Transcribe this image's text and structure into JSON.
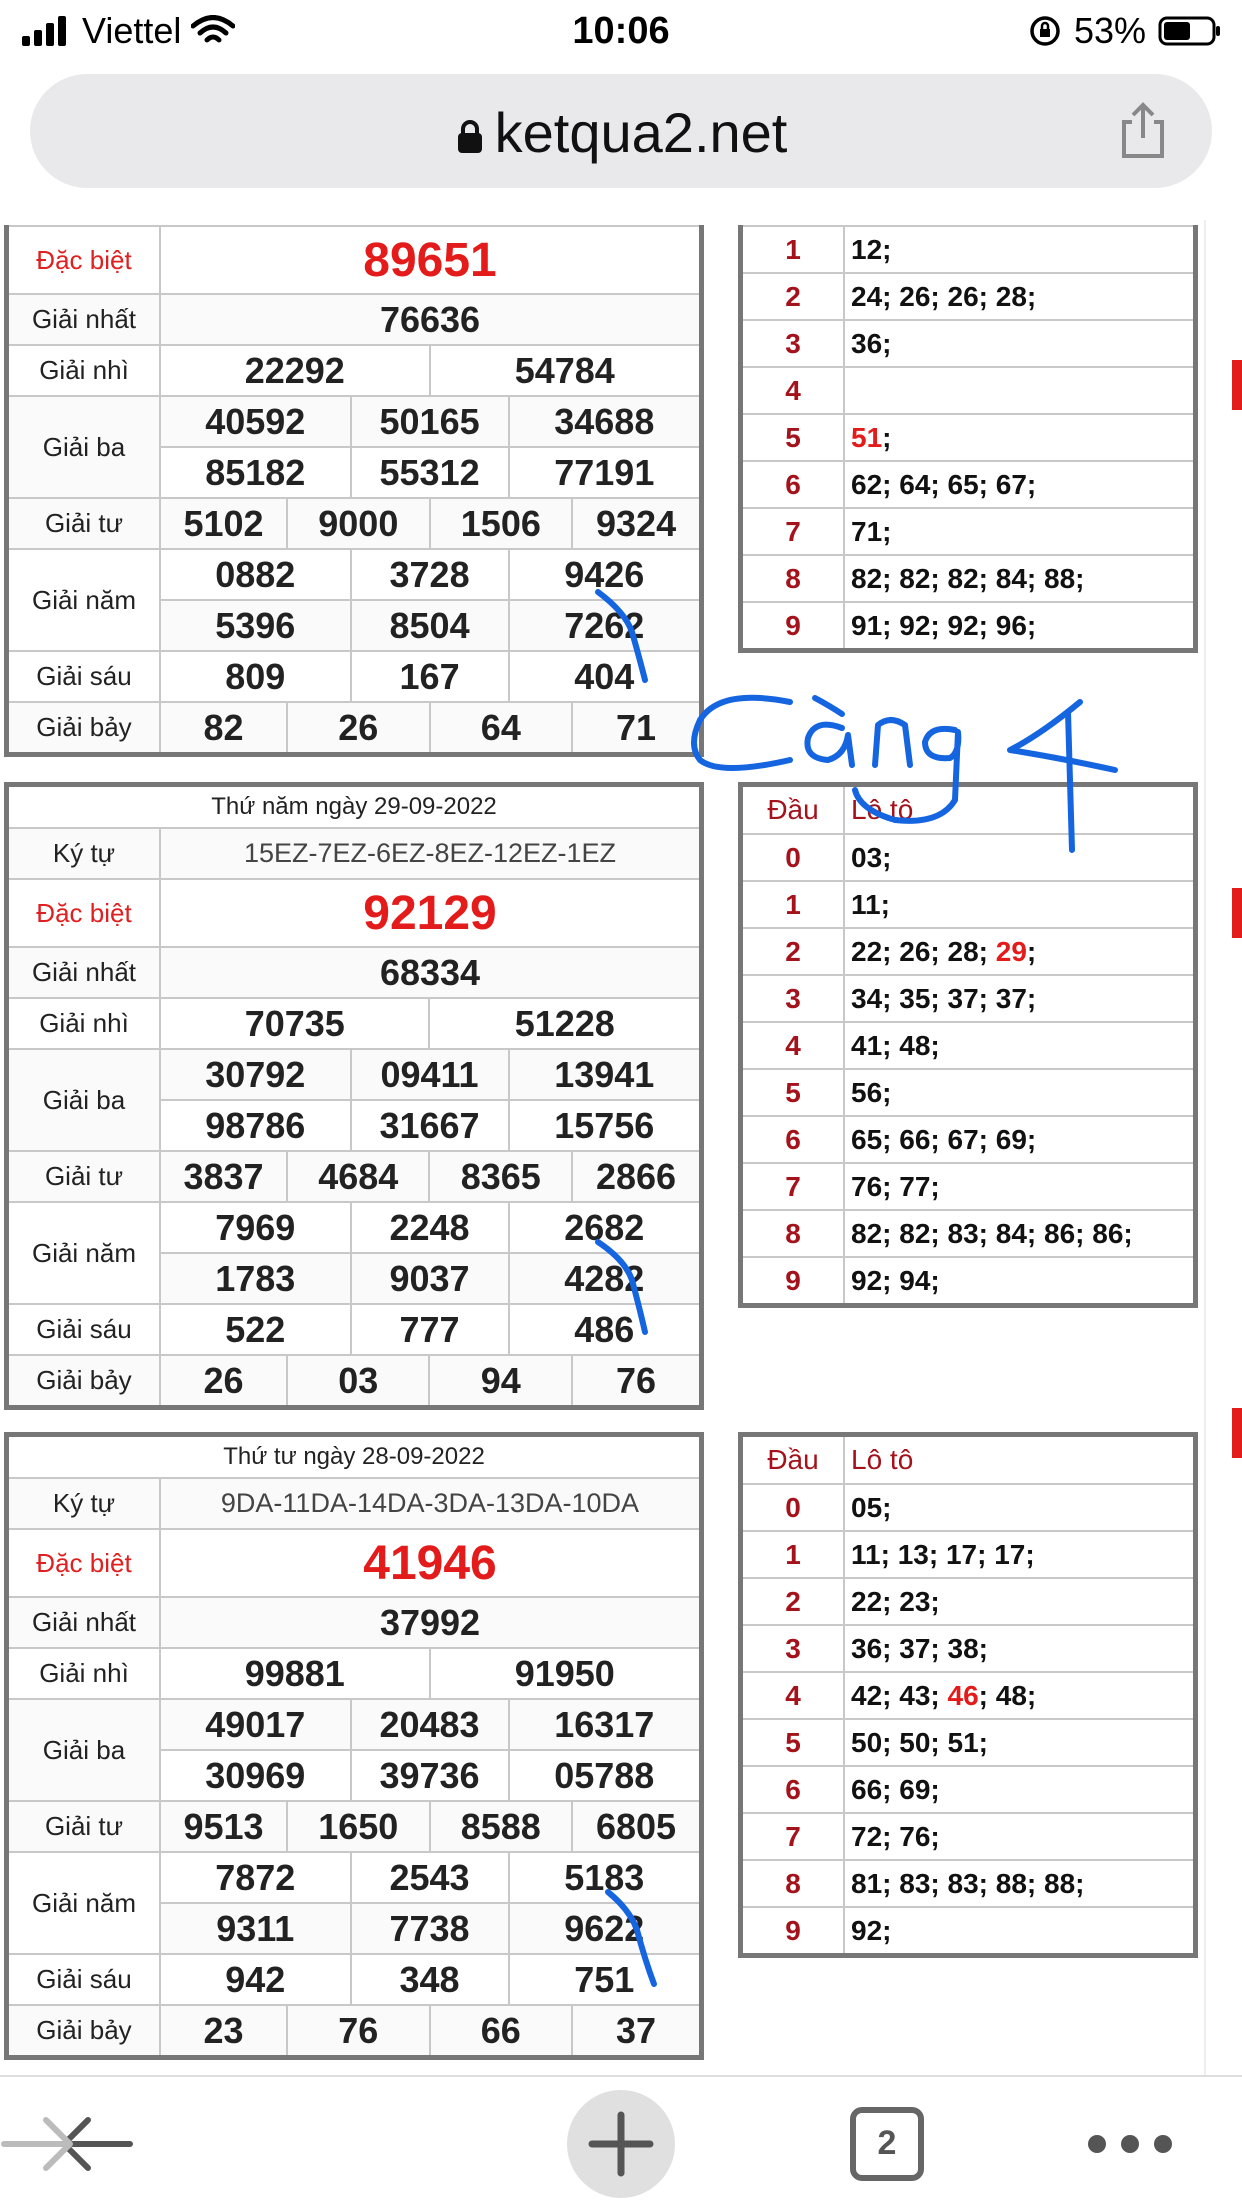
{
  "status": {
    "carrier": "Viettel",
    "time": "10:06",
    "battery": "53%"
  },
  "browser": {
    "url": "ketqua2.net",
    "tab_count": "2"
  },
  "labels": {
    "ky_tu": "Ký tự",
    "dac_biet": "Đặc biệt",
    "giai_nhat": "Giải nhất",
    "giai_nhi": "Giải nhì",
    "giai_ba": "Giải ba",
    "giai_tu": "Giải tư",
    "giai_nam": "Giải năm",
    "giai_sau": "Giải sáu",
    "giai_bay": "Giải bảy",
    "dau": "Đầu",
    "loto": "Lô tô"
  },
  "result1": {
    "dac_biet": "89651",
    "giai_nhat": "76636",
    "giai_nhi": [
      "22292",
      "54784"
    ],
    "giai_ba": [
      "40592",
      "50165",
      "34688",
      "85182",
      "55312",
      "77191"
    ],
    "giai_tu": [
      "5102",
      "9000",
      "1506",
      "9324"
    ],
    "giai_nam": [
      "0882",
      "3728",
      "9426",
      "5396",
      "8504",
      "7262"
    ],
    "giai_sau": [
      "809",
      "167",
      "404"
    ],
    "giai_bay": [
      "82",
      "26",
      "64",
      "71"
    ]
  },
  "loto1": [
    {
      "dau": "1",
      "val": "12;"
    },
    {
      "dau": "2",
      "val": "24; 26; 26; 28;"
    },
    {
      "dau": "3",
      "val": "36;"
    },
    {
      "dau": "4",
      "val": ""
    },
    {
      "dau": "5",
      "pre": "",
      "hl": "51",
      "post": ";"
    },
    {
      "dau": "6",
      "val": "62; 64; 65; 67;"
    },
    {
      "dau": "7",
      "val": "71;"
    },
    {
      "dau": "8",
      "val": "82; 82; 82; 84; 88;"
    },
    {
      "dau": "9",
      "val": "91; 92; 92; 96;"
    }
  ],
  "result2": {
    "heading": "Thứ năm ngày 29-09-2022",
    "ky_tu": "15EZ-7EZ-6EZ-8EZ-12EZ-1EZ",
    "dac_biet": "92129",
    "giai_nhat": "68334",
    "giai_nhi": [
      "70735",
      "51228"
    ],
    "giai_ba": [
      "30792",
      "09411",
      "13941",
      "98786",
      "31667",
      "15756"
    ],
    "giai_tu": [
      "3837",
      "4684",
      "8365",
      "2866"
    ],
    "giai_nam": [
      "7969",
      "2248",
      "2682",
      "1783",
      "9037",
      "4282"
    ],
    "giai_sau": [
      "522",
      "777",
      "486"
    ],
    "giai_bay": [
      "26",
      "03",
      "94",
      "76"
    ]
  },
  "loto2": [
    {
      "dau": "0",
      "val": "03;"
    },
    {
      "dau": "1",
      "val": "11;"
    },
    {
      "dau": "2",
      "pre": "22; 26; 28; ",
      "hl": "29",
      "post": ";"
    },
    {
      "dau": "3",
      "val": "34; 35; 37; 37;"
    },
    {
      "dau": "4",
      "val": "41; 48;"
    },
    {
      "dau": "5",
      "val": "56;"
    },
    {
      "dau": "6",
      "val": "65; 66; 67; 69;"
    },
    {
      "dau": "7",
      "val": "76; 77;"
    },
    {
      "dau": "8",
      "val": "82; 82; 83; 84; 86; 86;"
    },
    {
      "dau": "9",
      "val": "92; 94;"
    }
  ],
  "result3": {
    "heading": "Thứ tư ngày 28-09-2022",
    "ky_tu": "9DA-11DA-14DA-3DA-13DA-10DA",
    "dac_biet": "41946",
    "giai_nhat": "37992",
    "giai_nhi": [
      "99881",
      "91950"
    ],
    "giai_ba": [
      "49017",
      "20483",
      "16317",
      "30969",
      "39736",
      "05788"
    ],
    "giai_tu": [
      "9513",
      "1650",
      "8588",
      "6805"
    ],
    "giai_nam": [
      "7872",
      "2543",
      "5183",
      "9311",
      "7738",
      "9622"
    ],
    "giai_sau": [
      "942",
      "348",
      "751"
    ],
    "giai_bay": [
      "23",
      "76",
      "66",
      "37"
    ]
  },
  "loto3": [
    {
      "dau": "0",
      "val": "05;"
    },
    {
      "dau": "1",
      "val": "11; 13; 17; 17;"
    },
    {
      "dau": "2",
      "val": "22; 23;"
    },
    {
      "dau": "3",
      "val": "36; 37; 38;"
    },
    {
      "dau": "4",
      "pre": "42; 43; ",
      "hl": "46",
      "post": "; 48;"
    },
    {
      "dau": "5",
      "val": "50; 50; 51;"
    },
    {
      "dau": "6",
      "val": "66; 69;"
    },
    {
      "dau": "7",
      "val": "72; 76;"
    },
    {
      "dau": "8",
      "val": "81; 83; 83; 88; 88;"
    },
    {
      "dau": "9",
      "val": "92;"
    }
  ],
  "annotation": {
    "text": "Càng 4",
    "color": "#1565e0"
  }
}
